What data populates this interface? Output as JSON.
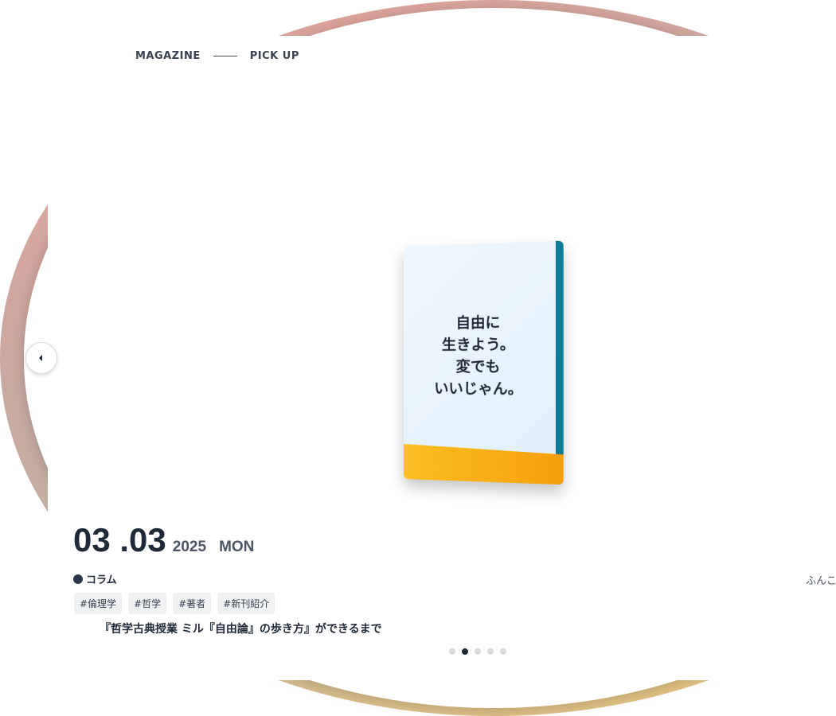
{
  "breadcrumb": {
    "parent": "MAGAZINE",
    "current": "PICK UP"
  },
  "book": {
    "title": "自由に\n生きよう。\n変でも\nいいじゃん。"
  },
  "article": {
    "date_main": "03 .03",
    "year": "2025",
    "weekday": "MON",
    "category": "コラム",
    "author": "ふんこ",
    "tags": [
      "#倫理学",
      "#哲学",
      "#著者",
      "#新刊紹介"
    ],
    "headline": "『哲学古典授業 ミル『自由論』の歩き方』ができるまで"
  },
  "carousel": {
    "dot_count": 5,
    "active_index": 1
  },
  "colors": {
    "gradient_start": "#e8a095",
    "gradient_end": "#e9c57a",
    "book_spine": "#0e7c95",
    "book_band": "#f59e0b",
    "text_dark": "#1f2937"
  }
}
